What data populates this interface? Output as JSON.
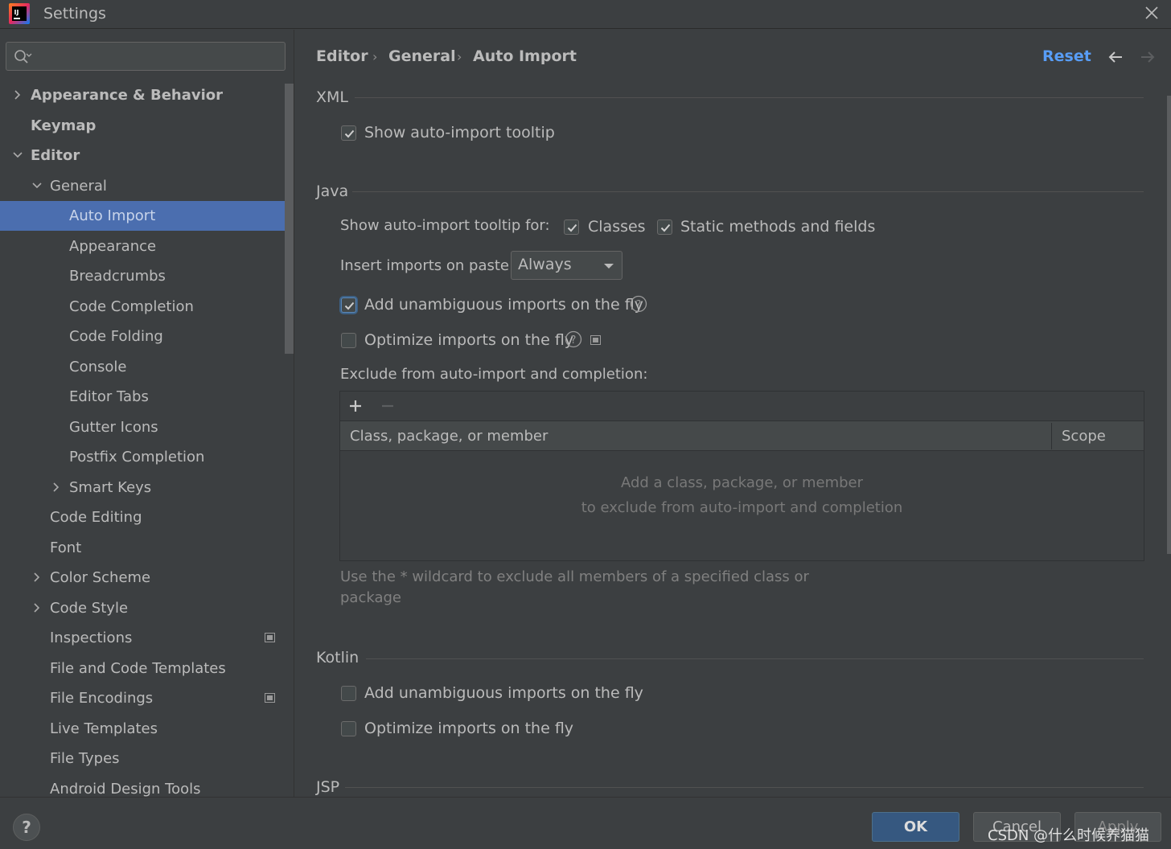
{
  "window": {
    "title": "Settings"
  },
  "sidebar": {
    "search_placeholder": "",
    "items": [
      {
        "label": "Appearance & Behavior",
        "arrow": "right"
      },
      {
        "label": "Keymap",
        "arrow": ""
      },
      {
        "label": "Editor",
        "arrow": "down"
      },
      {
        "label": "General",
        "arrow": "down"
      },
      {
        "label": "Auto Import",
        "arrow": "",
        "selected": true
      },
      {
        "label": "Appearance",
        "arrow": ""
      },
      {
        "label": "Breadcrumbs",
        "arrow": ""
      },
      {
        "label": "Code Completion",
        "arrow": ""
      },
      {
        "label": "Code Folding",
        "arrow": ""
      },
      {
        "label": "Console",
        "arrow": ""
      },
      {
        "label": "Editor Tabs",
        "arrow": ""
      },
      {
        "label": "Gutter Icons",
        "arrow": ""
      },
      {
        "label": "Postfix Completion",
        "arrow": ""
      },
      {
        "label": "Smart Keys",
        "arrow": "right"
      },
      {
        "label": "Code Editing",
        "arrow": ""
      },
      {
        "label": "Font",
        "arrow": ""
      },
      {
        "label": "Color Scheme",
        "arrow": "right"
      },
      {
        "label": "Code Style",
        "arrow": "right"
      },
      {
        "label": "Inspections",
        "arrow": "",
        "badge": true
      },
      {
        "label": "File and Code Templates",
        "arrow": ""
      },
      {
        "label": "File Encodings",
        "arrow": "",
        "badge": true
      },
      {
        "label": "Live Templates",
        "arrow": ""
      },
      {
        "label": "File Types",
        "arrow": ""
      },
      {
        "label": "Android Design Tools",
        "arrow": ""
      }
    ]
  },
  "header": {
    "breadcrumb": [
      "Editor",
      "General",
      "Auto Import"
    ],
    "separator": "›",
    "reset_label": "Reset"
  },
  "xml": {
    "title": "XML",
    "show_tooltip_label": "Show auto-import tooltip",
    "show_tooltip_checked": true
  },
  "java": {
    "title": "Java",
    "tooltip_for_label": "Show auto-import tooltip for:",
    "classes_label": "Classes",
    "classes_checked": true,
    "static_label": "Static methods and fields",
    "static_checked": true,
    "paste_label": "Insert imports on paste:",
    "paste_value": "Always",
    "unambiguous_label": "Add unambiguous imports on the fly",
    "unambiguous_checked": true,
    "optimize_label": "Optimize imports on the fly",
    "optimize_checked": false,
    "exclude_label": "Exclude from auto-import and completion:",
    "table": {
      "add_icon": "plus-icon",
      "remove_icon": "minus-icon",
      "columns": [
        "Class, package, or member",
        "Scope"
      ],
      "empty_line1": "Add a class, package, or member",
      "empty_line2": "to exclude from auto-import and completion"
    },
    "wildcard_hint": "Use the * wildcard to exclude all members of a specified class or package"
  },
  "kotlin": {
    "title": "Kotlin",
    "unambiguous_label": "Add unambiguous imports on the fly",
    "unambiguous_checked": false,
    "optimize_label": "Optimize imports on the fly",
    "optimize_checked": false
  },
  "jsp": {
    "title": "JSP"
  },
  "footer": {
    "help_label": "?",
    "ok_label": "OK",
    "cancel_label": "Cancel",
    "apply_label": "Apply",
    "watermark": "CSDN @什么时候养猫猫"
  },
  "colors": {
    "background": "#3c3f41",
    "selection": "#4b6eaf",
    "link": "#589df6",
    "primary_button": "#365880"
  }
}
